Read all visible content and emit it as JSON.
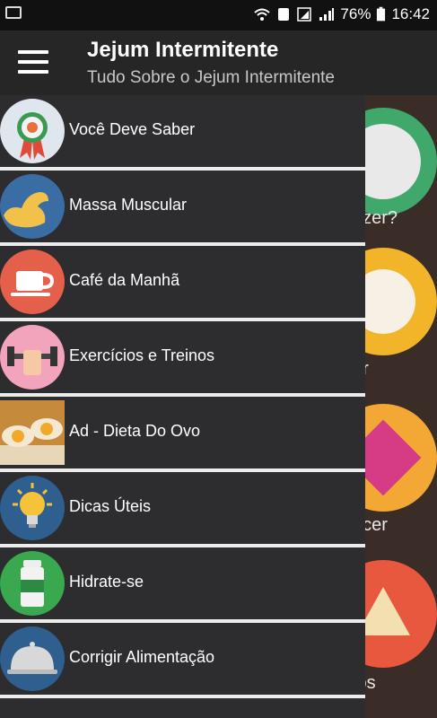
{
  "status": {
    "battery": "76%",
    "time": "16:42"
  },
  "appbar": {
    "title": "Jejum Intermitente",
    "subtitle": "Tudo Sobre o Jejum Intermitente"
  },
  "menu": [
    {
      "label": "Você Deve Saber",
      "icon": "award-badge-icon"
    },
    {
      "label": "Massa Muscular",
      "icon": "flexed-arm-icon"
    },
    {
      "label": "Café da Manhã",
      "icon": "coffee-cup-icon"
    },
    {
      "label": "Exercícios e Treinos",
      "icon": "dumbbell-icon"
    },
    {
      "label": "Ad - Dieta Do Ovo",
      "icon": "egg-toast-photo"
    },
    {
      "label": "Dicas Úteis",
      "icon": "lightbulb-icon"
    },
    {
      "label": "Hidrate-se",
      "icon": "water-bottle-icon"
    },
    {
      "label": "Corrigir Alimentação",
      "icon": "cloche-icon"
    }
  ],
  "background_labels": [
    "azer?",
    "er",
    "ecer",
    "los"
  ],
  "colors": {
    "drawer_bg": "#2d2c2f",
    "appbar_bg": "#262626",
    "divider": "#ececec"
  }
}
